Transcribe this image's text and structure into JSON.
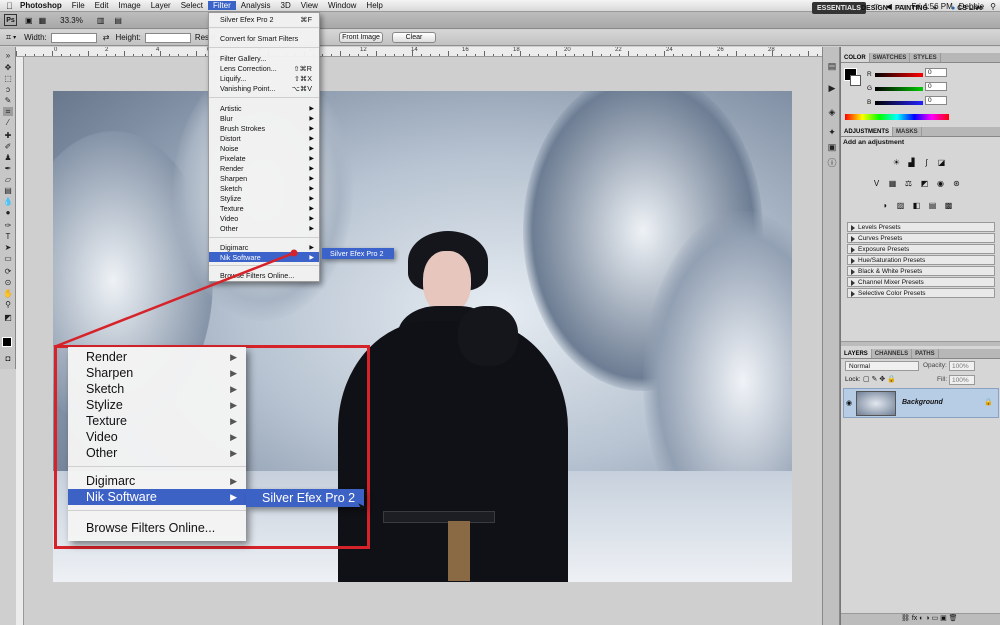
{
  "menubar": {
    "app_name": "Photoshop",
    "items": [
      "File",
      "Edit",
      "Image",
      "Layer",
      "Select",
      "Filter",
      "Analysis",
      "3D",
      "View",
      "Window",
      "Help"
    ],
    "active_item": "Filter",
    "clock": "Fri 4:56 PM",
    "user": "Debbie"
  },
  "appbar": {
    "ps_logo": "Ps",
    "zoom": "33.3%",
    "workspaces": [
      "ESSENTIALS",
      "DESIGN",
      "PAINTING"
    ],
    "more": "»",
    "cs_live": "CS Live"
  },
  "options": {
    "width_label": "Width:",
    "height_label": "Height:",
    "resolution_label": "Resol",
    "front_image": "Front Image",
    "clear": "Clear"
  },
  "filter_menu": {
    "last_filter": "Silver Efex Pro 2",
    "last_filter_shortcut": "⌘F",
    "convert": "Convert for Smart Filters",
    "gallery": "Filter Gallery...",
    "lens": "Lens Correction...",
    "lens_shortcut": "⇧⌘R",
    "liquify": "Liquify...",
    "liquify_shortcut": "⇧⌘X",
    "vanishing": "Vanishing Point...",
    "vanishing_shortcut": "⌥⌘V",
    "groups": [
      "Artistic",
      "Blur",
      "Brush Strokes",
      "Distort",
      "Noise",
      "Pixelate",
      "Render",
      "Sharpen",
      "Sketch",
      "Stylize",
      "Texture",
      "Video",
      "Other"
    ],
    "plugins": [
      "Digimarc",
      "Nik Software"
    ],
    "browse": "Browse Filters Online...",
    "submenu_item": "Silver Efex Pro 2"
  },
  "zoom_callout": {
    "groups": [
      "Render",
      "Sharpen",
      "Sketch",
      "Stylize",
      "Texture",
      "Video",
      "Other"
    ],
    "plugins": [
      "Digimarc",
      "Nik Software"
    ],
    "browse": "Browse Filters Online...",
    "submenu_item": "Silver Efex Pro 2"
  },
  "color_panel": {
    "tabs": [
      "COLOR",
      "SWATCHES",
      "STYLES"
    ],
    "channels": [
      {
        "label": "R",
        "value": "0"
      },
      {
        "label": "G",
        "value": "0"
      },
      {
        "label": "B",
        "value": "0"
      }
    ]
  },
  "adjustments_panel": {
    "tabs": [
      "ADJUSTMENTS",
      "MASKS"
    ],
    "title": "Add an adjustment",
    "presets": [
      "Levels Presets",
      "Curves Presets",
      "Exposure Presets",
      "Hue/Saturation Presets",
      "Black & White Presets",
      "Channel Mixer Presets",
      "Selective Color Presets"
    ]
  },
  "layers_panel": {
    "tabs": [
      "LAYERS",
      "CHANNELS",
      "PATHS"
    ],
    "blend_mode": "Normal",
    "opacity_label": "Opacity:",
    "opacity": "100%",
    "lock_label": "Lock:",
    "fill_label": "Fill:",
    "fill": "100%",
    "layer_name": "Background"
  },
  "ruler_numbers": [
    "0",
    "2",
    "4",
    "6",
    "8",
    "10",
    "12",
    "14",
    "16",
    "18",
    "20",
    "22",
    "24",
    "26",
    "28"
  ],
  "colors": {
    "menu_highlight": "#3b63c9",
    "callout_red": "#d6232a"
  }
}
